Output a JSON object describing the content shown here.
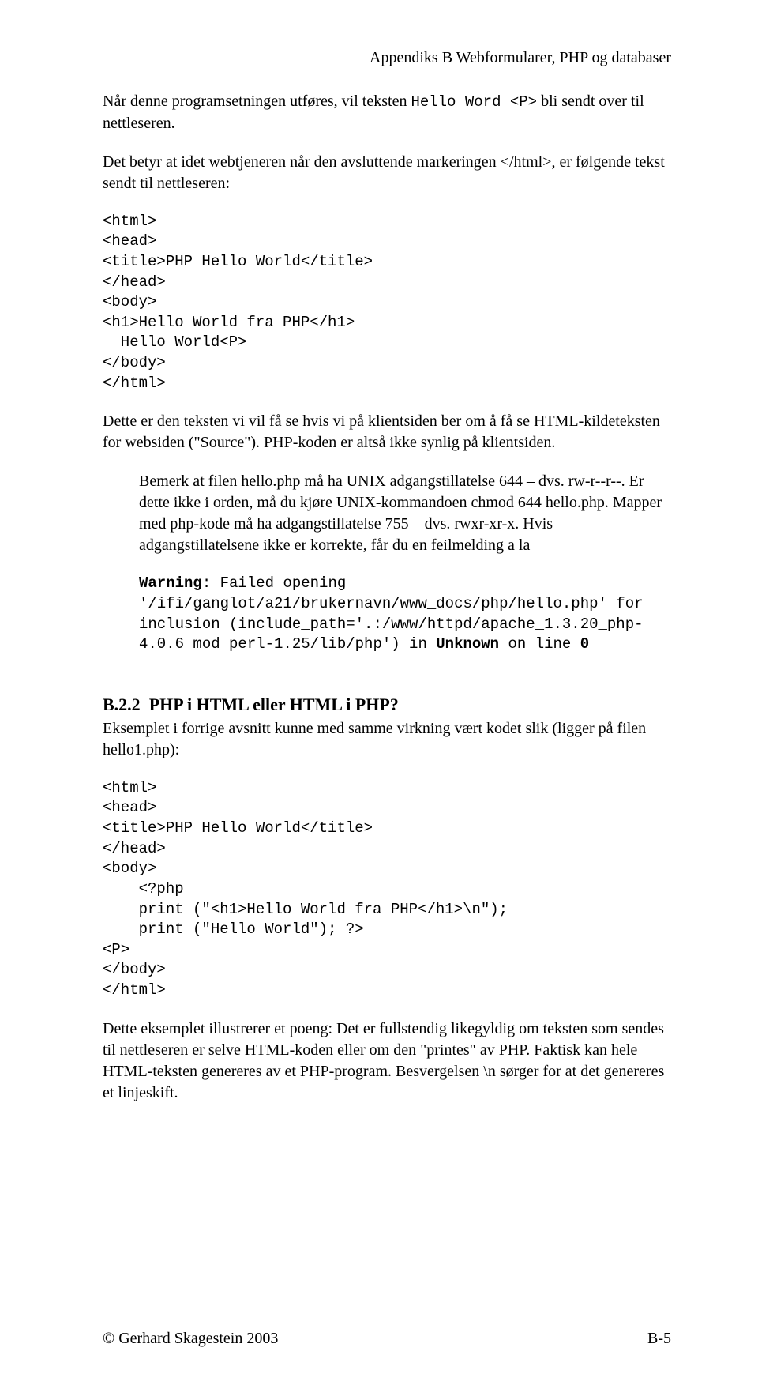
{
  "header": {
    "right": "Appendiks B Webformularer, PHP og databaser"
  },
  "para1_a": "Når denne programsetningen utføres, vil teksten ",
  "para1_code": "Hello Word <P>",
  "para1_b": " bli sendt over til nettleseren.",
  "para2": "Det betyr at idet webtjeneren når den avsluttende markeringen </html>, er følgende tekst sendt til nettleseren:",
  "code1": "<html>\n<head>\n<title>PHP Hello World</title>\n</head>\n<body>\n<h1>Hello World fra PHP</h1>\n  Hello World<P>\n</body>\n</html>",
  "para3": "Dette er den teksten vi vil få se hvis vi på klientsiden ber om å få se HTML-kildeteksten for websiden (\"Source\"). PHP-koden er altså ikke synlig på klientsiden.",
  "indent_para1": "Bemerk at filen hello.php må ha UNIX adgangstillatelse 644 – dvs. rw-r--r--. Er dette ikke i orden, må du kjøre UNIX-kommandoen chmod 644 hello.php. Mapper med php-kode må ha adgangstillatelse 755 – dvs. rwxr-xr-x. Hvis adgangstillatelsene ikke er korrekte, får du en feilmelding a la",
  "warning_bold1": "Warning",
  "warning_l1b": ": Failed opening",
  "warning_l2": "'/ifi/ganglot/a21/brukernavn/www_docs/php/hello.php' for",
  "warning_l3": "inclusion (include_path='.:/www/httpd/apache_1.3.20_php-",
  "warning_l4a": "4.0.6_mod_perl-1.25/lib/php') in ",
  "warning_bold2": "Unknown",
  "warning_l4b": " on line ",
  "warning_bold3": "0",
  "section_num": "B.2.2",
  "section_title": "PHP i HTML eller HTML i PHP?",
  "para4": "Eksemplet i forrige avsnitt kunne med samme virkning vært kodet slik (ligger på filen hello1.php):",
  "code2": "<html>\n<head>\n<title>PHP Hello World</title>\n</head>\n<body>\n    <?php\n    print (\"<h1>Hello World fra PHP</h1>\\n\");\n    print (\"Hello World\"); ?>\n<P>\n</body>\n</html>",
  "para5": "Dette eksemplet illustrerer et poeng: Det er fullstendig likegyldig om teksten som sendes til nettleseren er selve HTML-koden eller om den \"printes\" av PHP. Faktisk kan hele HTML-teksten genereres av et PHP-program. Besvergelsen \\n sørger for at det genereres et linjeskift.",
  "footer": {
    "left": "© Gerhard Skagestein 2003",
    "right": "B-5"
  }
}
